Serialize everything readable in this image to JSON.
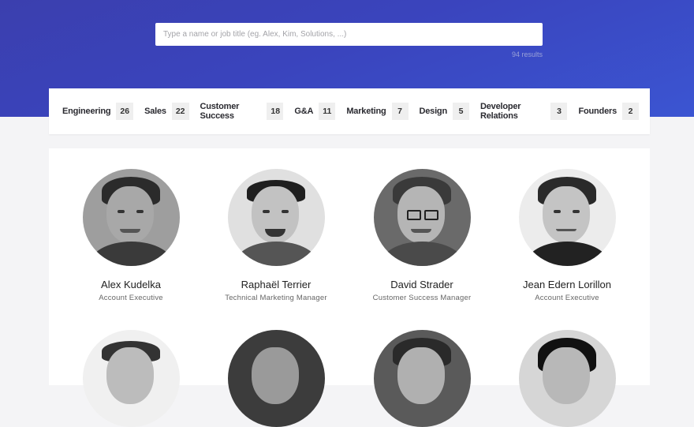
{
  "search": {
    "placeholder": "Type a name or job title (eg. Alex, Kim, Solutions, ...)",
    "results_text": "94 results"
  },
  "tabs": [
    {
      "label": "Engineering",
      "count": "26"
    },
    {
      "label": "Sales",
      "count": "22"
    },
    {
      "label": "Customer Success",
      "count": "18"
    },
    {
      "label": "G&A",
      "count": "11"
    },
    {
      "label": "Marketing",
      "count": "7"
    },
    {
      "label": "Design",
      "count": "5"
    },
    {
      "label": "Developer Relations",
      "count": "3"
    },
    {
      "label": "Founders",
      "count": "2"
    }
  ],
  "people": [
    {
      "name": "Alex Kudelka",
      "role": "Account Executive"
    },
    {
      "name": "Raphaël Terrier",
      "role": "Technical Marketing Manager"
    },
    {
      "name": "David Strader",
      "role": "Customer Success Manager"
    },
    {
      "name": "Jean Edern Lorillon",
      "role": "Account Executive"
    }
  ],
  "colors": {
    "hero_start": "#3b3fae",
    "hero_end": "#3b55d2",
    "tab_count_bg": "#efefef"
  }
}
